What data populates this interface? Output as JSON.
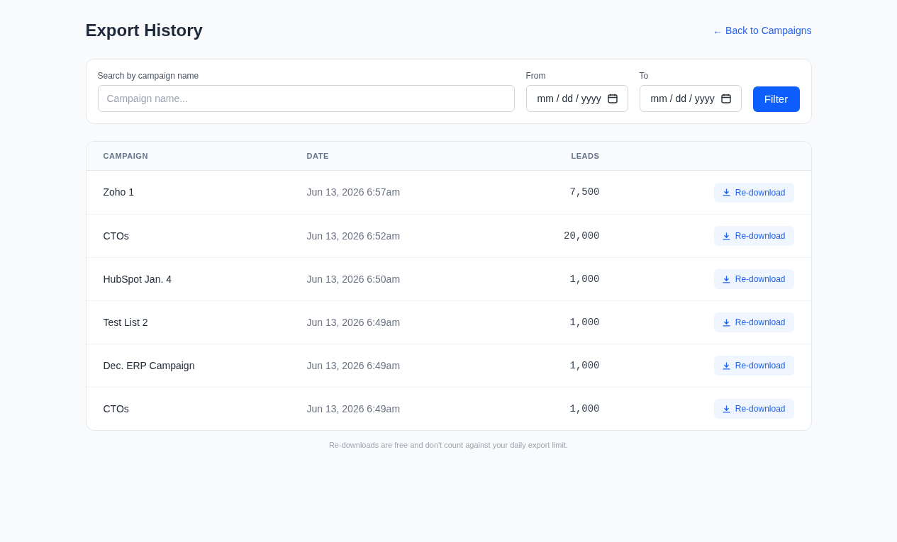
{
  "header": {
    "title": "Export History",
    "back_link": "← Back to Campaigns"
  },
  "filters": {
    "search": {
      "label": "Search by campaign name",
      "placeholder": "Campaign name..."
    },
    "from": {
      "label": "From",
      "placeholder": "mm / dd / yyyy"
    },
    "to": {
      "label": "To",
      "placeholder": "mm / dd / yyyy"
    },
    "button": "Filter"
  },
  "table": {
    "columns": [
      "CAMPAIGN",
      "DATE",
      "LEADS"
    ],
    "rows": [
      {
        "campaign": "Zoho 1",
        "date": "Jun 13, 2026 6:57am",
        "leads": "7,500",
        "action": "Re-download"
      },
      {
        "campaign": "CTOs",
        "date": "Jun 13, 2026 6:52am",
        "leads": "20,000",
        "action": "Re-download"
      },
      {
        "campaign": "HubSpot Jan. 4",
        "date": "Jun 13, 2026 6:50am",
        "leads": "1,000",
        "action": "Re-download"
      },
      {
        "campaign": "Test List 2",
        "date": "Jun 13, 2026 6:49am",
        "leads": "1,000",
        "action": "Re-download"
      },
      {
        "campaign": "Dec. ERP Campaign",
        "date": "Jun 13, 2026 6:49am",
        "leads": "1,000",
        "action": "Re-download"
      },
      {
        "campaign": "CTOs",
        "date": "Jun 13, 2026 6:49am",
        "leads": "1,000",
        "action": "Re-download"
      }
    ]
  },
  "footer_note": "Re-downloads are free and don't count against your daily export limit."
}
